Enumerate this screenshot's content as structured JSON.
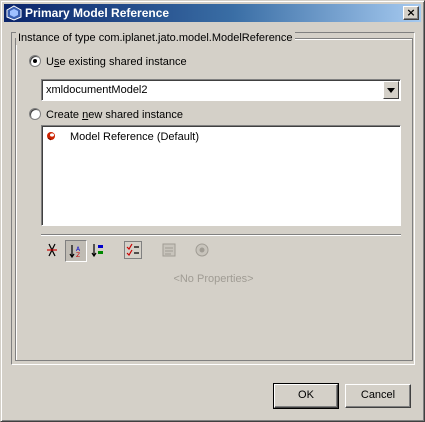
{
  "window": {
    "title": "Primary Model Reference",
    "close_label": "×"
  },
  "group": {
    "legend": "Instance of type com.iplanet.jato.model.ModelReference"
  },
  "use_existing": {
    "label_pre": "U",
    "label_mnemonic": "s",
    "label_post": "e existing shared instance",
    "selected": true
  },
  "combo": {
    "value": "xmldocumentModel2"
  },
  "create_new": {
    "label_pre": "Create ",
    "label_mnemonic": "n",
    "label_post": "ew shared instance",
    "selected": false
  },
  "list": {
    "items": [
      {
        "label": "Model Reference (Default)",
        "icon": "bean-icon"
      }
    ]
  },
  "toolbar": {
    "buttons": [
      {
        "icon": "sort-unsorted-icon",
        "pressed": false,
        "enabled": true
      },
      {
        "icon": "sort-by-name-icon",
        "pressed": true,
        "enabled": true
      },
      {
        "icon": "sort-by-type-icon",
        "pressed": false,
        "enabled": true
      },
      {
        "icon": "show-editable-only-icon",
        "pressed": false,
        "enabled": true
      },
      {
        "icon": "customize-icon",
        "pressed": false,
        "enabled": false
      },
      {
        "icon": "help-icon",
        "pressed": false,
        "enabled": false
      }
    ]
  },
  "properties": {
    "empty_text": "<No Properties>"
  },
  "buttons": {
    "ok": "OK",
    "cancel": "Cancel"
  },
  "colors": {
    "title_gradient_start": "#0a246a",
    "title_gradient_end": "#a6caf0",
    "face": "#d4d0c8",
    "bean_red": "#cc2200"
  }
}
